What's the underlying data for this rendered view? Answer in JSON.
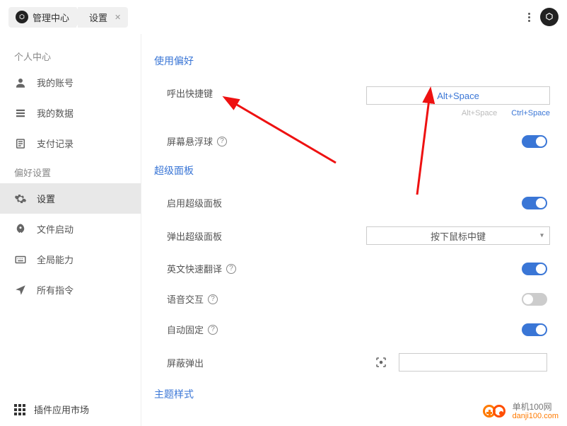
{
  "breadcrumb": {
    "root": "管理中心",
    "current": "设置"
  },
  "sidebar": {
    "sections": [
      {
        "title": "个人中心",
        "items": [
          {
            "icon": "user",
            "label": "我的账号"
          },
          {
            "icon": "list",
            "label": "我的数据"
          },
          {
            "icon": "receipt",
            "label": "支付记录"
          }
        ]
      },
      {
        "title": "偏好设置",
        "items": [
          {
            "icon": "gear",
            "label": "设置",
            "active": true
          },
          {
            "icon": "rocket",
            "label": "文件启动"
          },
          {
            "icon": "keyboard",
            "label": "全局能力"
          },
          {
            "icon": "send",
            "label": "所有指令"
          }
        ]
      }
    ],
    "footer": {
      "label": "插件应用市场"
    }
  },
  "content": {
    "groups": [
      {
        "title": "使用偏好",
        "rows": [
          {
            "label": "呼出快捷键",
            "type": "hotkey",
            "value": "Alt+Space",
            "options": [
              {
                "label": "Alt+Space",
                "selected": false
              },
              {
                "label": "Ctrl+Space",
                "selected": true
              }
            ]
          },
          {
            "label": "屏幕悬浮球",
            "help": true,
            "type": "toggle",
            "value": true
          }
        ]
      },
      {
        "title": "超级面板",
        "rows": [
          {
            "label": "启用超级面板",
            "type": "toggle",
            "value": true
          },
          {
            "label": "弹出超级面板",
            "type": "select",
            "value": "按下鼠标中键"
          },
          {
            "label": "英文快速翻译",
            "help": true,
            "type": "toggle",
            "value": true
          },
          {
            "label": "语音交互",
            "help": true,
            "type": "toggle",
            "value": false
          },
          {
            "label": "自动固定",
            "help": true,
            "type": "toggle",
            "value": true
          },
          {
            "label": "屏蔽弹出",
            "type": "scan-input"
          }
        ]
      },
      {
        "title": "主题样式",
        "rows": []
      }
    ]
  },
  "watermark": {
    "name": "单机100网",
    "url": "danji100.com"
  }
}
